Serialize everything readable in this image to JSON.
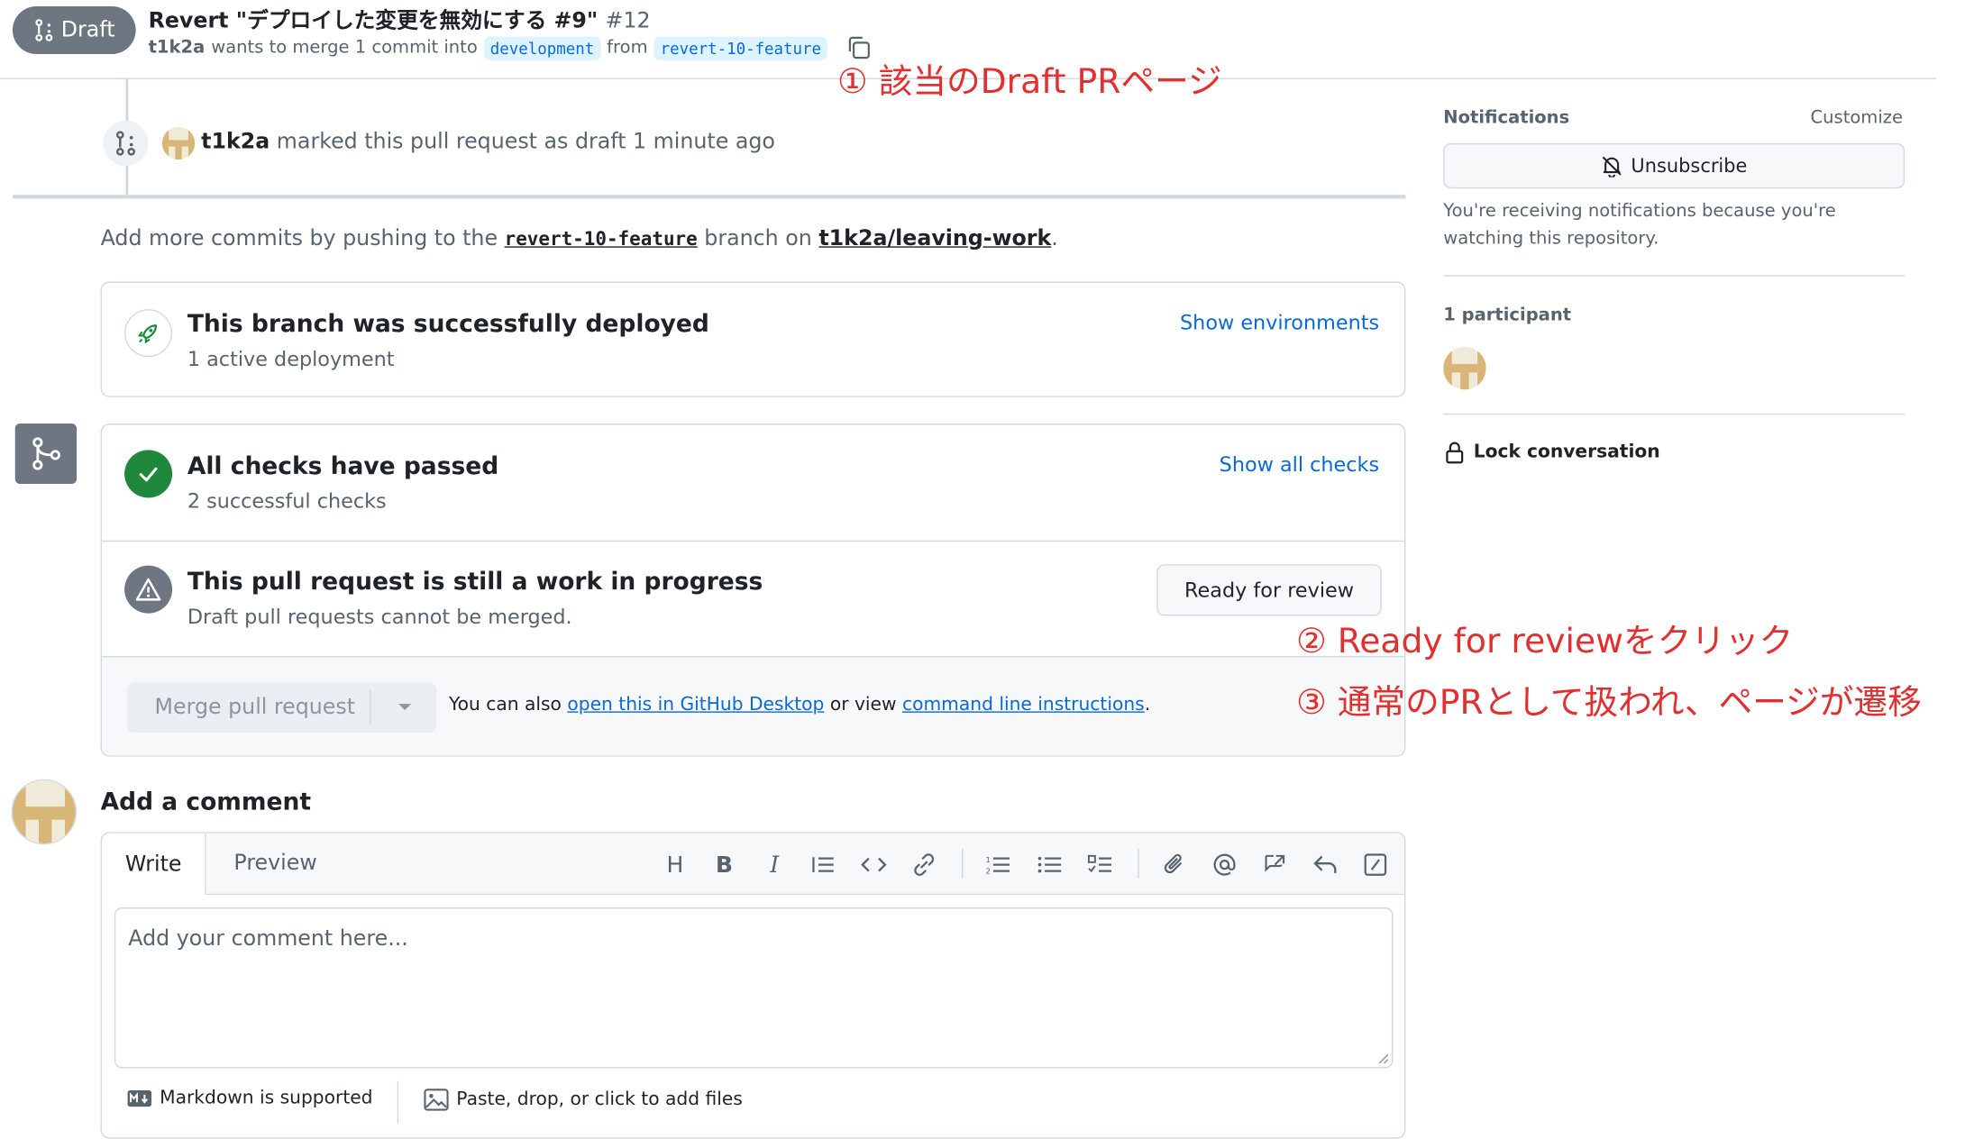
{
  "header": {
    "status": "Draft",
    "title": "Revert \"デプロイした変更を無効にする #9\"",
    "number": "#12",
    "author": "t1k2a",
    "merge_text": "wants to merge 1 commit into",
    "base_branch": "development",
    "from_text": "from",
    "head_branch": "revert-10-feature"
  },
  "timeline": {
    "actor": "t1k2a",
    "event_text": "marked this pull request as draft 1 minute ago"
  },
  "add_more": {
    "prefix": "Add more commits by pushing to the",
    "branch": "revert-10-feature",
    "mid": "branch on",
    "repo": "t1k2a/leaving-work",
    "suffix": "."
  },
  "deployment": {
    "title": "This branch was successfully deployed",
    "subtitle": "1 active deployment",
    "link": "Show environments"
  },
  "checks": {
    "title": "All checks have passed",
    "subtitle": "2 successful checks",
    "link": "Show all checks"
  },
  "wip": {
    "title": "This pull request is still a work in progress",
    "subtitle": "Draft pull requests cannot be merged.",
    "button": "Ready for review"
  },
  "merge": {
    "button": "Merge pull request",
    "also_text": "You can also",
    "desktop_link": "open this in GitHub Desktop",
    "or_text": "or view",
    "cli_link": "command line instructions",
    "end": "."
  },
  "comment": {
    "heading": "Add a comment",
    "tab_write": "Write",
    "tab_preview": "Preview",
    "placeholder": "Add your comment here...",
    "markdown_note": "Markdown is supported",
    "files_note": "Paste, drop, or click to add files"
  },
  "sidebar": {
    "notifications_label": "Notifications",
    "customize": "Customize",
    "unsubscribe": "Unsubscribe",
    "notif_reason": "You're receiving notifications because you're watching this repository.",
    "participants": "1 participant",
    "lock": "Lock conversation"
  },
  "annotations": {
    "a1": "① 該当のDraft PRページ",
    "a2": "② Ready for reviewをクリック",
    "a3": "③ 通常のPRとして扱われ、ページが遷移"
  },
  "colors": {
    "accent": "#0969da",
    "success": "#1f883d",
    "draft": "#6e7781",
    "annotation": "#e0302f"
  }
}
